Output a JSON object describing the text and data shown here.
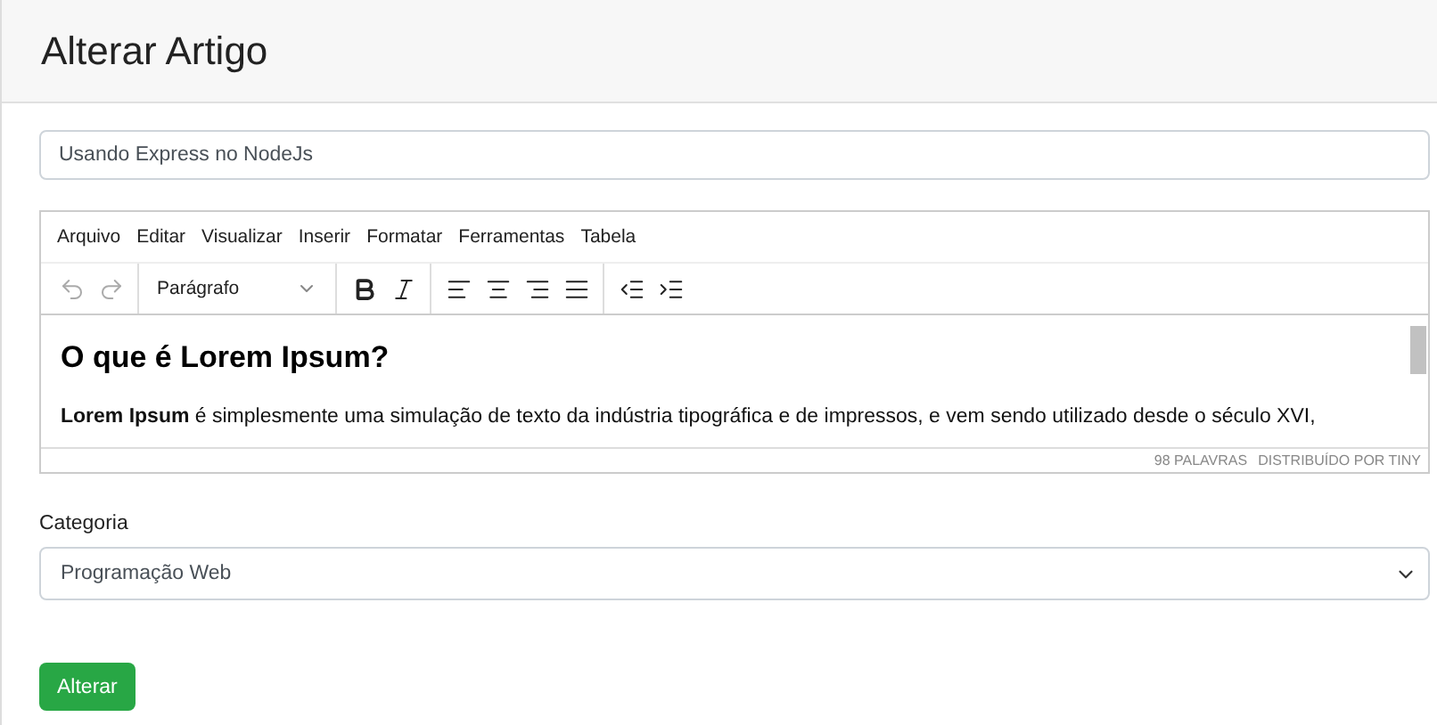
{
  "card": {
    "title": "Alterar Artigo"
  },
  "title_field": {
    "value": "Usando Express no NodeJs"
  },
  "editor": {
    "menu": [
      "Arquivo",
      "Editar",
      "Visualizar",
      "Inserir",
      "Formatar",
      "Ferramentas",
      "Tabela"
    ],
    "toolbar": [
      {
        "kind": "undo",
        "disabled": true
      },
      {
        "kind": "redo",
        "disabled": true
      },
      {
        "kind": "block",
        "label": "Parágrafo"
      },
      {
        "kind": "bold"
      },
      {
        "kind": "italic"
      },
      {
        "kind": "align-left"
      },
      {
        "kind": "align-center"
      },
      {
        "kind": "align-right"
      },
      {
        "kind": "align-justify"
      },
      {
        "kind": "outdent"
      },
      {
        "kind": "indent"
      }
    ],
    "heading": "O que é Lorem Ipsum?",
    "paragraph": "**Lorem Ipsum** é simplesmente uma simulação de texto da indústria tipográfica e de impressos, e vem sendo utilizado desde o século XVI,",
    "word_count": "98 PALAVRAS",
    "branding": "DISTRIBUÍDO POR TINY"
  },
  "category": {
    "label": "Categoria",
    "value": "Programação Web"
  },
  "submit": {
    "label": "Alterar"
  }
}
